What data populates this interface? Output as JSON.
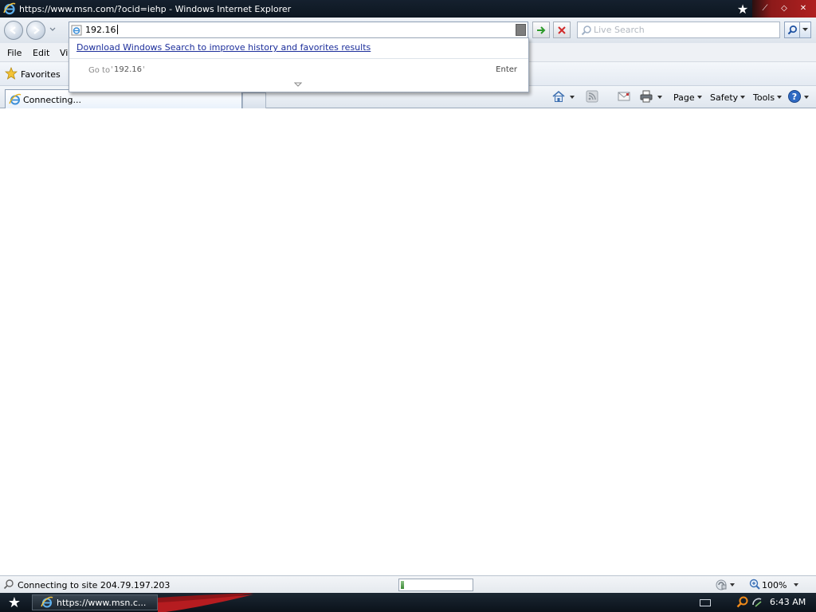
{
  "window": {
    "title": "https://www.msn.com/?ocid=iehp - Windows Internet Explorer"
  },
  "address_bar": {
    "value": "192.16"
  },
  "search": {
    "placeholder": "Live Search"
  },
  "menu": {
    "items": [
      "File",
      "Edit",
      "Vi"
    ]
  },
  "favorites": {
    "label": "Favorites"
  },
  "tab": {
    "label": "Connecting..."
  },
  "command_bar": {
    "page": "Page",
    "safety": "Safety",
    "tools": "Tools"
  },
  "dropdown": {
    "download_link": "Download Windows Search to improve history and favorites results",
    "goto_prefix": "Go to",
    "goto_value": "192.16",
    "enter_label": "Enter"
  },
  "status": {
    "text": "Connecting to site 204.79.197.203",
    "zoom": "100%"
  },
  "taskbar": {
    "task_label": "https://www.msn.c...",
    "clock": "6:43 AM"
  },
  "icons": {
    "browser": "ie-logo-icon",
    "back": "back-arrow-icon",
    "forward": "forward-arrow-icon",
    "go": "green-arrow-icon",
    "stop": "red-x-icon",
    "search": "magnifier-icon",
    "favorites": "star-icon",
    "home": "home-icon",
    "feeds": "rss-icon",
    "mail": "mail-icon",
    "print": "printer-icon",
    "help": "help-icon"
  },
  "colors": {
    "titlebar": "#15202e",
    "link": "#1c2e9b",
    "taskbar": "#0b121a",
    "accent_red": "#b02020"
  }
}
